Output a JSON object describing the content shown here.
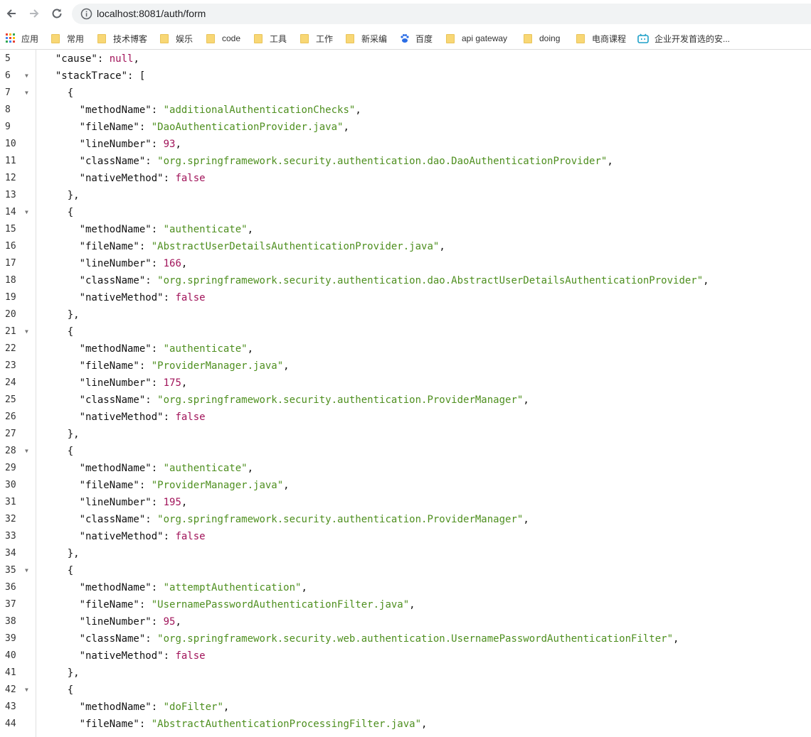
{
  "browser": {
    "url": "localhost:8081/auth/form",
    "back_label": "←",
    "forward_label": "→",
    "reload_label": "↻"
  },
  "bookmarks": [
    {
      "label": "应用",
      "icon": "apps-grid-icon"
    },
    {
      "label": "常用",
      "icon": "folder-icon"
    },
    {
      "label": "技术博客",
      "icon": "folder-icon"
    },
    {
      "label": "娱乐",
      "icon": "folder-icon"
    },
    {
      "label": "code",
      "icon": "folder-icon"
    },
    {
      "label": "工具",
      "icon": "folder-icon"
    },
    {
      "label": "工作",
      "icon": "folder-icon"
    },
    {
      "label": "新采编",
      "icon": "folder-icon"
    },
    {
      "label": "百度",
      "icon": "baidu-paw-icon"
    },
    {
      "label": "api gateway",
      "icon": "folder-icon"
    },
    {
      "label": "doing",
      "icon": "folder-icon"
    },
    {
      "label": "电商课程",
      "icon": "folder-icon"
    },
    {
      "label": "企业开发首选的安...",
      "icon": "bilibili-tv-icon"
    }
  ],
  "colors": {
    "string": "#4e8f1f",
    "number": "#a1145a",
    "key": "#111111"
  },
  "code_lines": [
    {
      "num": "5",
      "fold": false,
      "indent": "  ",
      "tokens": [
        {
          "t": "k",
          "v": "\"cause\""
        },
        {
          "t": "p",
          "v": ": "
        },
        {
          "t": "b",
          "v": "null"
        },
        {
          "t": "p",
          "v": ","
        }
      ]
    },
    {
      "num": "6",
      "fold": true,
      "indent": "  ",
      "tokens": [
        {
          "t": "k",
          "v": "\"stackTrace\""
        },
        {
          "t": "p",
          "v": ": ["
        }
      ]
    },
    {
      "num": "7",
      "fold": true,
      "indent": "    ",
      "tokens": [
        {
          "t": "p",
          "v": "{"
        }
      ]
    },
    {
      "num": "8",
      "fold": false,
      "indent": "      ",
      "tokens": [
        {
          "t": "k",
          "v": "\"methodName\""
        },
        {
          "t": "p",
          "v": ": "
        },
        {
          "t": "s",
          "v": "\"additionalAuthenticationChecks\""
        },
        {
          "t": "p",
          "v": ","
        }
      ]
    },
    {
      "num": "9",
      "fold": false,
      "indent": "      ",
      "tokens": [
        {
          "t": "k",
          "v": "\"fileName\""
        },
        {
          "t": "p",
          "v": ": "
        },
        {
          "t": "s",
          "v": "\"DaoAuthenticationProvider.java\""
        },
        {
          "t": "p",
          "v": ","
        }
      ]
    },
    {
      "num": "10",
      "fold": false,
      "indent": "      ",
      "tokens": [
        {
          "t": "k",
          "v": "\"lineNumber\""
        },
        {
          "t": "p",
          "v": ": "
        },
        {
          "t": "n",
          "v": "93"
        },
        {
          "t": "p",
          "v": ","
        }
      ]
    },
    {
      "num": "11",
      "fold": false,
      "indent": "      ",
      "tokens": [
        {
          "t": "k",
          "v": "\"className\""
        },
        {
          "t": "p",
          "v": ": "
        },
        {
          "t": "s",
          "v": "\"org.springframework.security.authentication.dao.DaoAuthenticationProvider\""
        },
        {
          "t": "p",
          "v": ","
        }
      ]
    },
    {
      "num": "12",
      "fold": false,
      "indent": "      ",
      "tokens": [
        {
          "t": "k",
          "v": "\"nativeMethod\""
        },
        {
          "t": "p",
          "v": ": "
        },
        {
          "t": "b",
          "v": "false"
        }
      ]
    },
    {
      "num": "13",
      "fold": false,
      "indent": "    ",
      "tokens": [
        {
          "t": "p",
          "v": "},"
        }
      ]
    },
    {
      "num": "14",
      "fold": true,
      "indent": "    ",
      "tokens": [
        {
          "t": "p",
          "v": "{"
        }
      ]
    },
    {
      "num": "15",
      "fold": false,
      "indent": "      ",
      "tokens": [
        {
          "t": "k",
          "v": "\"methodName\""
        },
        {
          "t": "p",
          "v": ": "
        },
        {
          "t": "s",
          "v": "\"authenticate\""
        },
        {
          "t": "p",
          "v": ","
        }
      ]
    },
    {
      "num": "16",
      "fold": false,
      "indent": "      ",
      "tokens": [
        {
          "t": "k",
          "v": "\"fileName\""
        },
        {
          "t": "p",
          "v": ": "
        },
        {
          "t": "s",
          "v": "\"AbstractUserDetailsAuthenticationProvider.java\""
        },
        {
          "t": "p",
          "v": ","
        }
      ]
    },
    {
      "num": "17",
      "fold": false,
      "indent": "      ",
      "tokens": [
        {
          "t": "k",
          "v": "\"lineNumber\""
        },
        {
          "t": "p",
          "v": ": "
        },
        {
          "t": "n",
          "v": "166"
        },
        {
          "t": "p",
          "v": ","
        }
      ]
    },
    {
      "num": "18",
      "fold": false,
      "indent": "      ",
      "tokens": [
        {
          "t": "k",
          "v": "\"className\""
        },
        {
          "t": "p",
          "v": ": "
        },
        {
          "t": "s",
          "v": "\"org.springframework.security.authentication.dao.AbstractUserDetailsAuthenticationProvider\""
        },
        {
          "t": "p",
          "v": ","
        }
      ]
    },
    {
      "num": "19",
      "fold": false,
      "indent": "      ",
      "tokens": [
        {
          "t": "k",
          "v": "\"nativeMethod\""
        },
        {
          "t": "p",
          "v": ": "
        },
        {
          "t": "b",
          "v": "false"
        }
      ]
    },
    {
      "num": "20",
      "fold": false,
      "indent": "    ",
      "tokens": [
        {
          "t": "p",
          "v": "},"
        }
      ]
    },
    {
      "num": "21",
      "fold": true,
      "indent": "    ",
      "tokens": [
        {
          "t": "p",
          "v": "{"
        }
      ]
    },
    {
      "num": "22",
      "fold": false,
      "indent": "      ",
      "tokens": [
        {
          "t": "k",
          "v": "\"methodName\""
        },
        {
          "t": "p",
          "v": ": "
        },
        {
          "t": "s",
          "v": "\"authenticate\""
        },
        {
          "t": "p",
          "v": ","
        }
      ]
    },
    {
      "num": "23",
      "fold": false,
      "indent": "      ",
      "tokens": [
        {
          "t": "k",
          "v": "\"fileName\""
        },
        {
          "t": "p",
          "v": ": "
        },
        {
          "t": "s",
          "v": "\"ProviderManager.java\""
        },
        {
          "t": "p",
          "v": ","
        }
      ]
    },
    {
      "num": "24",
      "fold": false,
      "indent": "      ",
      "tokens": [
        {
          "t": "k",
          "v": "\"lineNumber\""
        },
        {
          "t": "p",
          "v": ": "
        },
        {
          "t": "n",
          "v": "175"
        },
        {
          "t": "p",
          "v": ","
        }
      ]
    },
    {
      "num": "25",
      "fold": false,
      "indent": "      ",
      "tokens": [
        {
          "t": "k",
          "v": "\"className\""
        },
        {
          "t": "p",
          "v": ": "
        },
        {
          "t": "s",
          "v": "\"org.springframework.security.authentication.ProviderManager\""
        },
        {
          "t": "p",
          "v": ","
        }
      ]
    },
    {
      "num": "26",
      "fold": false,
      "indent": "      ",
      "tokens": [
        {
          "t": "k",
          "v": "\"nativeMethod\""
        },
        {
          "t": "p",
          "v": ": "
        },
        {
          "t": "b",
          "v": "false"
        }
      ]
    },
    {
      "num": "27",
      "fold": false,
      "indent": "    ",
      "tokens": [
        {
          "t": "p",
          "v": "},"
        }
      ]
    },
    {
      "num": "28",
      "fold": true,
      "indent": "    ",
      "tokens": [
        {
          "t": "p",
          "v": "{"
        }
      ]
    },
    {
      "num": "29",
      "fold": false,
      "indent": "      ",
      "tokens": [
        {
          "t": "k",
          "v": "\"methodName\""
        },
        {
          "t": "p",
          "v": ": "
        },
        {
          "t": "s",
          "v": "\"authenticate\""
        },
        {
          "t": "p",
          "v": ","
        }
      ]
    },
    {
      "num": "30",
      "fold": false,
      "indent": "      ",
      "tokens": [
        {
          "t": "k",
          "v": "\"fileName\""
        },
        {
          "t": "p",
          "v": ": "
        },
        {
          "t": "s",
          "v": "\"ProviderManager.java\""
        },
        {
          "t": "p",
          "v": ","
        }
      ]
    },
    {
      "num": "31",
      "fold": false,
      "indent": "      ",
      "tokens": [
        {
          "t": "k",
          "v": "\"lineNumber\""
        },
        {
          "t": "p",
          "v": ": "
        },
        {
          "t": "n",
          "v": "195"
        },
        {
          "t": "p",
          "v": ","
        }
      ]
    },
    {
      "num": "32",
      "fold": false,
      "indent": "      ",
      "tokens": [
        {
          "t": "k",
          "v": "\"className\""
        },
        {
          "t": "p",
          "v": ": "
        },
        {
          "t": "s",
          "v": "\"org.springframework.security.authentication.ProviderManager\""
        },
        {
          "t": "p",
          "v": ","
        }
      ]
    },
    {
      "num": "33",
      "fold": false,
      "indent": "      ",
      "tokens": [
        {
          "t": "k",
          "v": "\"nativeMethod\""
        },
        {
          "t": "p",
          "v": ": "
        },
        {
          "t": "b",
          "v": "false"
        }
      ]
    },
    {
      "num": "34",
      "fold": false,
      "indent": "    ",
      "tokens": [
        {
          "t": "p",
          "v": "},"
        }
      ]
    },
    {
      "num": "35",
      "fold": true,
      "indent": "    ",
      "tokens": [
        {
          "t": "p",
          "v": "{"
        }
      ]
    },
    {
      "num": "36",
      "fold": false,
      "indent": "      ",
      "tokens": [
        {
          "t": "k",
          "v": "\"methodName\""
        },
        {
          "t": "p",
          "v": ": "
        },
        {
          "t": "s",
          "v": "\"attemptAuthentication\""
        },
        {
          "t": "p",
          "v": ","
        }
      ]
    },
    {
      "num": "37",
      "fold": false,
      "indent": "      ",
      "tokens": [
        {
          "t": "k",
          "v": "\"fileName\""
        },
        {
          "t": "p",
          "v": ": "
        },
        {
          "t": "s",
          "v": "\"UsernamePasswordAuthenticationFilter.java\""
        },
        {
          "t": "p",
          "v": ","
        }
      ]
    },
    {
      "num": "38",
      "fold": false,
      "indent": "      ",
      "tokens": [
        {
          "t": "k",
          "v": "\"lineNumber\""
        },
        {
          "t": "p",
          "v": ": "
        },
        {
          "t": "n",
          "v": "95"
        },
        {
          "t": "p",
          "v": ","
        }
      ]
    },
    {
      "num": "39",
      "fold": false,
      "indent": "      ",
      "tokens": [
        {
          "t": "k",
          "v": "\"className\""
        },
        {
          "t": "p",
          "v": ": "
        },
        {
          "t": "s",
          "v": "\"org.springframework.security.web.authentication.UsernamePasswordAuthenticationFilter\""
        },
        {
          "t": "p",
          "v": ","
        }
      ]
    },
    {
      "num": "40",
      "fold": false,
      "indent": "      ",
      "tokens": [
        {
          "t": "k",
          "v": "\"nativeMethod\""
        },
        {
          "t": "p",
          "v": ": "
        },
        {
          "t": "b",
          "v": "false"
        }
      ]
    },
    {
      "num": "41",
      "fold": false,
      "indent": "    ",
      "tokens": [
        {
          "t": "p",
          "v": "},"
        }
      ]
    },
    {
      "num": "42",
      "fold": true,
      "indent": "    ",
      "tokens": [
        {
          "t": "p",
          "v": "{"
        }
      ]
    },
    {
      "num": "43",
      "fold": false,
      "indent": "      ",
      "tokens": [
        {
          "t": "k",
          "v": "\"methodName\""
        },
        {
          "t": "p",
          "v": ": "
        },
        {
          "t": "s",
          "v": "\"doFilter\""
        },
        {
          "t": "p",
          "v": ","
        }
      ]
    },
    {
      "num": "44",
      "fold": false,
      "indent": "      ",
      "tokens": [
        {
          "t": "k",
          "v": "\"fileName\""
        },
        {
          "t": "p",
          "v": ": "
        },
        {
          "t": "s",
          "v": "\"AbstractAuthenticationProcessingFilter.java\""
        },
        {
          "t": "p",
          "v": ","
        }
      ]
    }
  ]
}
